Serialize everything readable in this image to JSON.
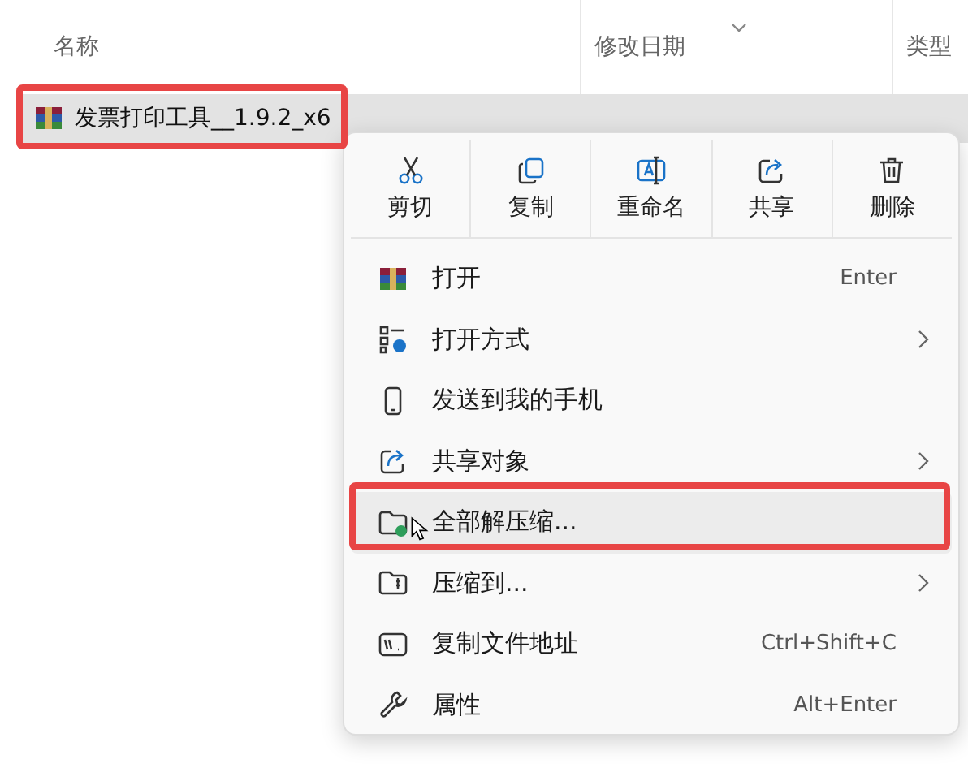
{
  "columns": [
    {
      "label": "名称"
    },
    {
      "label": "修改日期",
      "sorted": true
    },
    {
      "label": "类型"
    }
  ],
  "file": {
    "name": "发票打印工具__1.9.2_x6",
    "selected": true
  },
  "menu": {
    "toolbar": [
      {
        "label": "剪切"
      },
      {
        "label": "复制"
      },
      {
        "label": "重命名"
      },
      {
        "label": "共享"
      },
      {
        "label": "删除"
      }
    ],
    "items": [
      {
        "label": "打开",
        "shortcut": "Enter",
        "submenu": false,
        "selected": false
      },
      {
        "label": "打开方式",
        "submenu": true,
        "selected": false
      },
      {
        "label": "发送到我的手机",
        "submenu": false,
        "selected": false
      },
      {
        "label": "共享对象",
        "submenu": true,
        "selected": false
      },
      {
        "label": "全部解压缩...",
        "submenu": false,
        "selected": true
      },
      {
        "label": "压缩到...",
        "submenu": true,
        "selected": false
      },
      {
        "label": "复制文件地址",
        "shortcut": "Ctrl+Shift+C",
        "submenu": false,
        "selected": false
      },
      {
        "label": "属性",
        "shortcut": "Alt+Enter",
        "submenu": false,
        "selected": false
      }
    ]
  }
}
